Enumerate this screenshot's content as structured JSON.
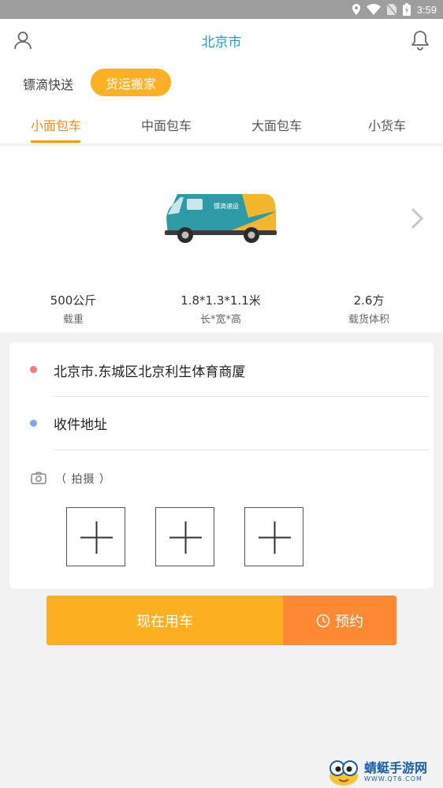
{
  "status_bar": {
    "time": "3:59"
  },
  "header": {
    "city": "北京市"
  },
  "modes": {
    "biaodi": "镖滴快送",
    "huoyun": "货运搬家"
  },
  "tabs": [
    {
      "label": "小面包车"
    },
    {
      "label": "中面包车"
    },
    {
      "label": "大面包车"
    },
    {
      "label": "小货车"
    }
  ],
  "vehicle": {
    "van_lettering": "镖滴速运",
    "specs": [
      {
        "value": "500公斤",
        "label": "载重"
      },
      {
        "value": "1.8*1.3*1.1米",
        "label": "长*宽*高"
      },
      {
        "value": "2.6方",
        "label": "载货体积"
      }
    ]
  },
  "address": {
    "pickup": "北京市.东城区北京利生体育商厦",
    "delivery_placeholder": "收件地址",
    "photo_label": "（ 拍摄 ）"
  },
  "buttons": {
    "now": "现在用车",
    "reserve": "预约"
  },
  "watermark": {
    "title": "蜻蜓手游网",
    "url": "WWW.QT6.COM"
  },
  "colors": {
    "accent_blue": "#1a9fd7",
    "accent_orange": "#fdb022",
    "reserve_orange": "#ff8a33",
    "pickup_dot": "#f47b7b",
    "delivery_dot": "#7ba6f0"
  }
}
